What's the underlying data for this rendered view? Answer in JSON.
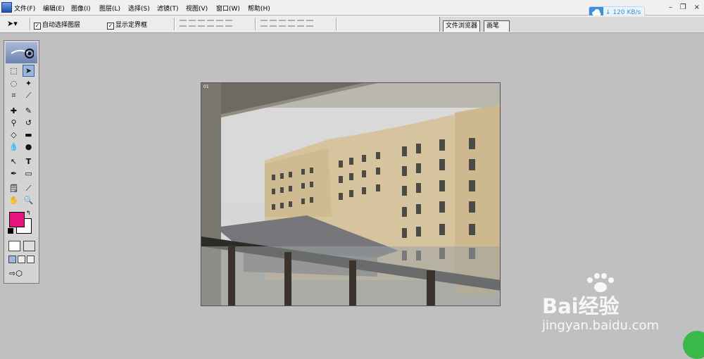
{
  "menu": {
    "items": [
      "文件(F)",
      "编辑(E)",
      "图像(I)",
      "图层(L)",
      "选择(S)",
      "滤镜(T)",
      "视图(V)",
      "窗口(W)",
      "帮助(H)"
    ]
  },
  "window_controls": {
    "minimize": "–",
    "restore": "❐",
    "close": "×"
  },
  "network": {
    "speed": "120 KB/s",
    "accent": "#3a8fde"
  },
  "options": {
    "auto_select_label": "自动选择图层",
    "show_bounds_label": "显示定界框",
    "auto_select_checked": true,
    "show_bounds_checked": true
  },
  "palette_well": {
    "tabs": [
      "文件浏览器",
      "画笔"
    ]
  },
  "toolbox": {
    "foreground_color": "#e8127f",
    "background_color": "#ffffff",
    "tools": [
      "marquee",
      "move",
      "lasso",
      "magic-wand",
      "crop",
      "slice",
      "healing-brush",
      "brush",
      "clone-stamp",
      "history-brush",
      "eraser",
      "gradient",
      "blur",
      "dodge",
      "path-select",
      "type",
      "pen",
      "shape",
      "notes",
      "eyedropper",
      "hand",
      "zoom"
    ]
  },
  "document": {
    "zoom_label": "01"
  },
  "watermark": {
    "brand": "Bai经验",
    "url": "jingyan.baidu.com"
  }
}
